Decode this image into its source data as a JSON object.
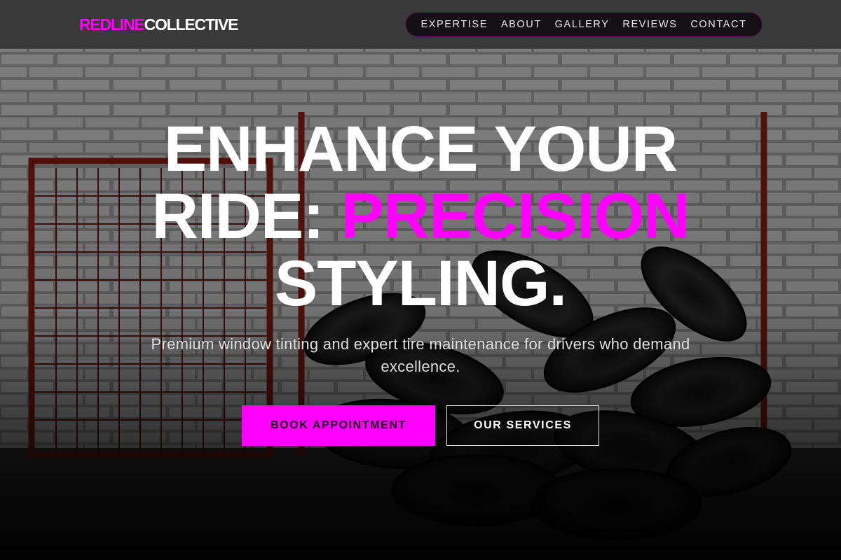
{
  "brand": {
    "part1": "REDLINE",
    "part2": "COLLECTIVE"
  },
  "nav": [
    {
      "label": "EXPERTISE"
    },
    {
      "label": "ABOUT"
    },
    {
      "label": "GALLERY"
    },
    {
      "label": "REVIEWS"
    },
    {
      "label": "CONTACT"
    }
  ],
  "hero": {
    "line1": "ENHANCE YOUR",
    "line2_prefix": "RIDE: ",
    "line2_accent": "PRECISION",
    "line3": "STYLING.",
    "subtitle": "Premium window tinting and expert tire maintenance for drivers who demand excellence.",
    "primary_cta": "BOOK APPOINTMENT",
    "secondary_cta": "OUR SERVICES"
  },
  "colors": {
    "accent": "#ff00ff",
    "header_bg": "#3a3a3a",
    "text": "#ffffff"
  },
  "background": {
    "description_icon": "garage-tires-photo"
  }
}
